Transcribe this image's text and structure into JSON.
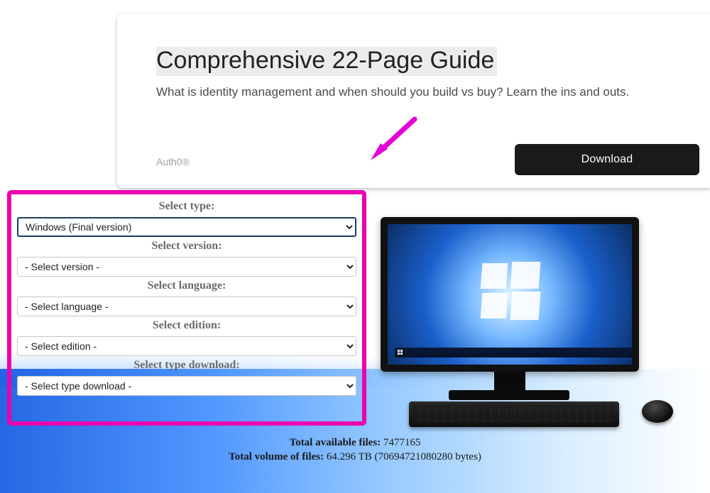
{
  "ad": {
    "title": "Comprehensive 22-Page Guide",
    "subtitle": "What is identity management and when should you build vs buy? Learn the ins and outs.",
    "brand": "Auth0®",
    "cta": "Download"
  },
  "panel": {
    "fields": {
      "type": {
        "label": "Select type:",
        "value": "Windows (Final version)"
      },
      "version": {
        "label": "Select version:",
        "value": "- Select version -"
      },
      "language": {
        "label": "Select language:",
        "value": "- Select language -"
      },
      "edition": {
        "label": "Select edition:",
        "value": "- Select edition -"
      },
      "download": {
        "label": "Select type download:",
        "value": "- Select type download -"
      }
    }
  },
  "stats": {
    "files_label": "Total available files: ",
    "files_value": "7477165",
    "volume_label": "Total volume of files: ",
    "volume_value": "64.296 TB (70694721080280 bytes)"
  },
  "colors": {
    "highlight": "#ea00b0",
    "arrow": "#e500d5"
  }
}
